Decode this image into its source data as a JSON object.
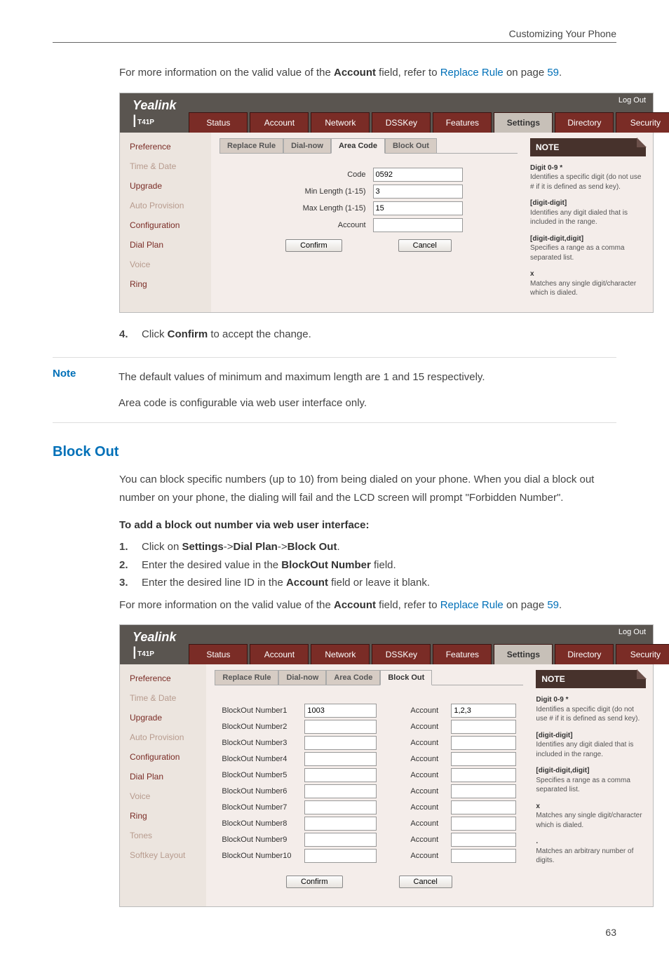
{
  "header": {
    "title": "Customizing Your Phone"
  },
  "intro": {
    "pre": "For more information on the valid value of the ",
    "bold": "Account",
    "post": " field, refer to ",
    "link": "Replace Rule",
    "tail": " on page ",
    "page": "59",
    "end": "."
  },
  "webui1": {
    "brand": "Yealink",
    "model": "T41P",
    "logout": "Log Out",
    "tabs": [
      "Status",
      "Account",
      "Network",
      "DSSKey",
      "Features",
      "Settings",
      "Directory",
      "Security"
    ],
    "active_tab": "Settings",
    "sidenav": [
      "Preference",
      "Time & Date",
      "Upgrade",
      "Auto Provision",
      "Configuration",
      "Dial Plan",
      "Voice",
      "Ring"
    ],
    "subtabs": [
      "Replace Rule",
      "Dial-now",
      "Area Code",
      "Block Out"
    ],
    "active_subtab": "Area Code",
    "fields": {
      "code_label": "Code",
      "code_value": "0592",
      "min_label": "Min Length (1-15)",
      "min_value": "3",
      "max_label": "Max Length (1-15)",
      "max_value": "15",
      "acct_label": "Account",
      "acct_value": ""
    },
    "confirm": "Confirm",
    "cancel": "Cancel",
    "note_head": "NOTE",
    "note_body": {
      "d1_h": "Digit 0-9 *",
      "d1_t": "Identifies a specific digit (do not use # if it is defined as send key).",
      "d2_h": "[digit-digit]",
      "d2_t": "Identifies any digit dialed that is included in the range.",
      "d3_h": "[digit-digit,digit]",
      "d3_t": "Specifies a range as a comma separated list.",
      "d4_h": "x",
      "d4_t": "Matches any single digit/character which is dialed."
    }
  },
  "step4": {
    "num": "4.",
    "pre": "Click ",
    "bold": "Confirm",
    "post": " to accept the change."
  },
  "note": {
    "label": "Note",
    "line1": "The default values of minimum and maximum length are 1 and 15 respectively.",
    "line2": "Area code is configurable via web user interface only."
  },
  "blockout": {
    "heading": "Block Out",
    "para": "You can block specific numbers (up to 10) from being dialed on your phone. When you dial a block out number on your phone, the dialing will fail and the LCD screen will prompt \"Forbidden Number\".",
    "proc_head": "To add a block out number via web user interface:",
    "step1": {
      "num": "1.",
      "pre": "Click on ",
      "b1": "Settings",
      "s1": "->",
      "b2": "Dial Plan",
      "s2": "->",
      "b3": "Block Out",
      "end": "."
    },
    "step2": {
      "num": "2.",
      "pre": "Enter the desired value in the ",
      "b": "BlockOut Number",
      "post": " field."
    },
    "step3": {
      "num": "3.",
      "pre": "Enter the desired line ID in the ",
      "b": "Account",
      "post": " field or leave it blank."
    },
    "info": {
      "pre": "For more information on the valid value of the ",
      "bold": "Account",
      "post": " field, refer to ",
      "link": "Replace Rule",
      "tail": " on page ",
      "page": "59",
      "end": "."
    }
  },
  "webui2": {
    "brand": "Yealink",
    "model": "T41P",
    "logout": "Log Out",
    "tabs": [
      "Status",
      "Account",
      "Network",
      "DSSKey",
      "Features",
      "Settings",
      "Directory",
      "Security"
    ],
    "active_tab": "Settings",
    "sidenav": [
      "Preference",
      "Time & Date",
      "Upgrade",
      "Auto Provision",
      "Configuration",
      "Dial Plan",
      "Voice",
      "Ring",
      "Tones",
      "Softkey Layout"
    ],
    "subtabs": [
      "Replace Rule",
      "Dial-now",
      "Area Code",
      "Block Out"
    ],
    "active_subtab": "Block Out",
    "rows": [
      {
        "label": "BlockOut Number1",
        "value": "1003",
        "acct": "1,2,3"
      },
      {
        "label": "BlockOut Number2",
        "value": "",
        "acct": ""
      },
      {
        "label": "BlockOut Number3",
        "value": "",
        "acct": ""
      },
      {
        "label": "BlockOut Number4",
        "value": "",
        "acct": ""
      },
      {
        "label": "BlockOut Number5",
        "value": "",
        "acct": ""
      },
      {
        "label": "BlockOut Number6",
        "value": "",
        "acct": ""
      },
      {
        "label": "BlockOut Number7",
        "value": "",
        "acct": ""
      },
      {
        "label": "BlockOut Number8",
        "value": "",
        "acct": ""
      },
      {
        "label": "BlockOut Number9",
        "value": "",
        "acct": ""
      },
      {
        "label": "BlockOut Number10",
        "value": "",
        "acct": ""
      }
    ],
    "acct_label": "Account",
    "confirm": "Confirm",
    "cancel": "Cancel",
    "note_head": "NOTE",
    "note_body": {
      "d1_h": "Digit 0-9 *",
      "d1_t": "Identifies a specific digit (do not use # if it is defined as send key).",
      "d2_h": "[digit-digit]",
      "d2_t": "Identifies any digit dialed that is included in the range.",
      "d3_h": "[digit-digit,digit]",
      "d3_t": "Specifies a range as a comma separated list.",
      "d4_h": "x",
      "d4_t": "Matches any single digit/character which is dialed.",
      "d5_h": ".",
      "d5_t": "Matches an arbitrary number of digits."
    }
  },
  "page_number": "63"
}
